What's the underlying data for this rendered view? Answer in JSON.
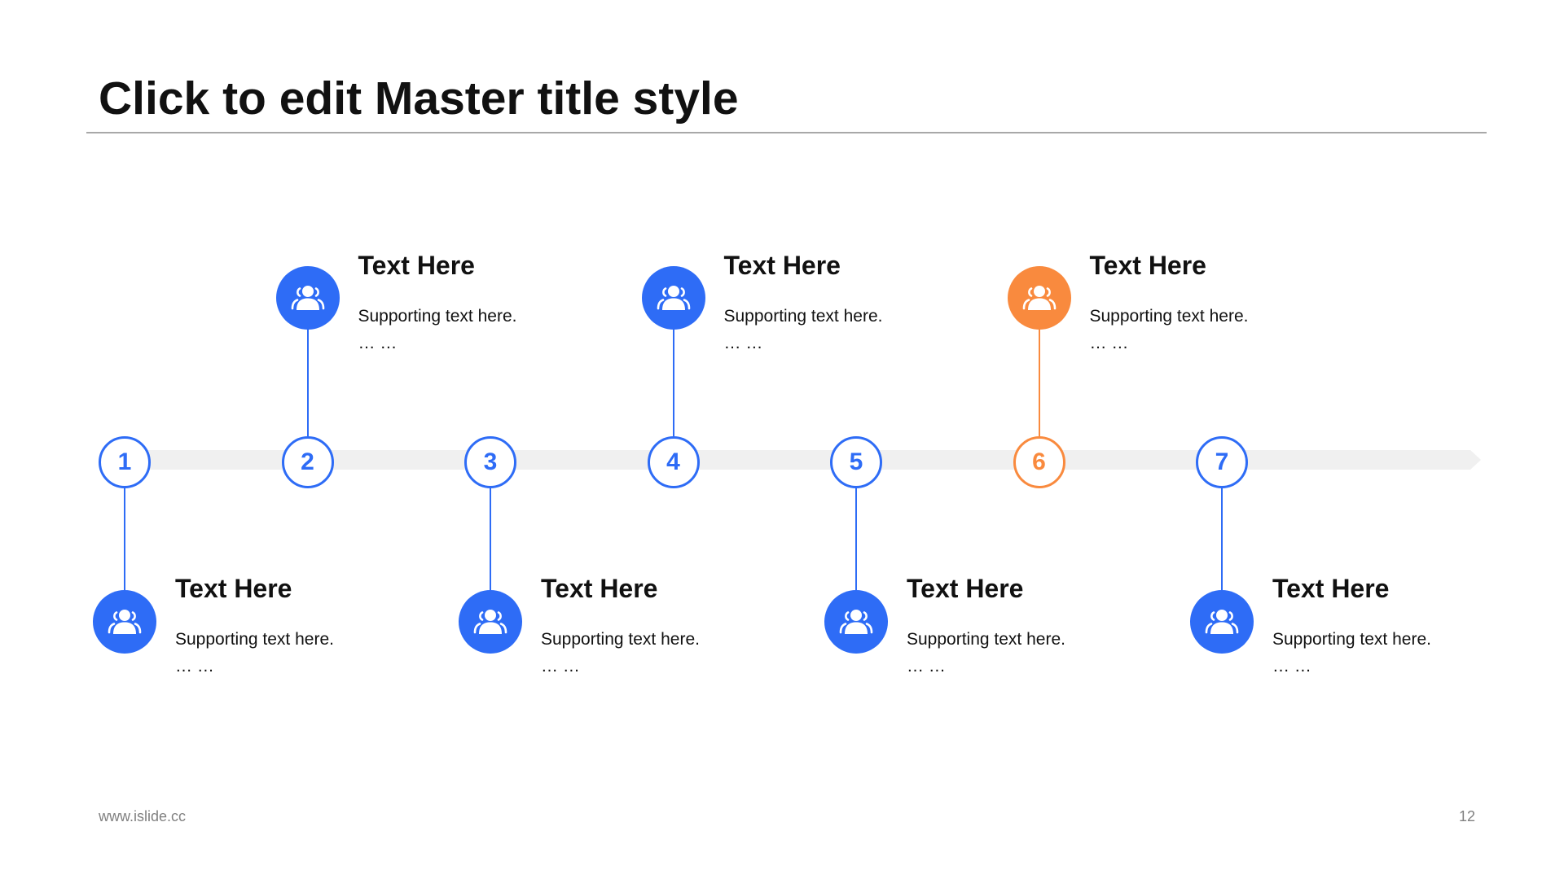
{
  "slide": {
    "title": "Click to edit Master title style",
    "footer_url": "www.islide.cc",
    "page_number": "12"
  },
  "colors": {
    "primary": "#2e6cf6",
    "accent": "#f98a3e",
    "track": "#f0f0f0",
    "rule": "#a8a8a8"
  },
  "milestones": [
    {
      "number": "1",
      "title": "Text Here",
      "line1": "Supporting text here.",
      "line2": "… …",
      "position": "below",
      "highlight": false,
      "icon": "people-icon"
    },
    {
      "number": "2",
      "title": "Text Here",
      "line1": "Supporting text here.",
      "line2": "… …",
      "position": "above",
      "highlight": false,
      "icon": "people-icon"
    },
    {
      "number": "3",
      "title": "Text Here",
      "line1": "Supporting text here.",
      "line2": "… …",
      "position": "below",
      "highlight": false,
      "icon": "people-icon"
    },
    {
      "number": "4",
      "title": "Text Here",
      "line1": "Supporting text here.",
      "line2": "… …",
      "position": "above",
      "highlight": false,
      "icon": "people-icon"
    },
    {
      "number": "5",
      "title": "Text Here",
      "line1": "Supporting text here.",
      "line2": "… …",
      "position": "below",
      "highlight": false,
      "icon": "people-icon"
    },
    {
      "number": "6",
      "title": "Text Here",
      "line1": "Supporting text here.",
      "line2": "… …",
      "position": "above",
      "highlight": true,
      "icon": "people-icon"
    },
    {
      "number": "7",
      "title": "Text Here",
      "line1": "Supporting text here.",
      "line2": "… …",
      "position": "below",
      "highlight": false,
      "icon": "people-icon"
    }
  ]
}
